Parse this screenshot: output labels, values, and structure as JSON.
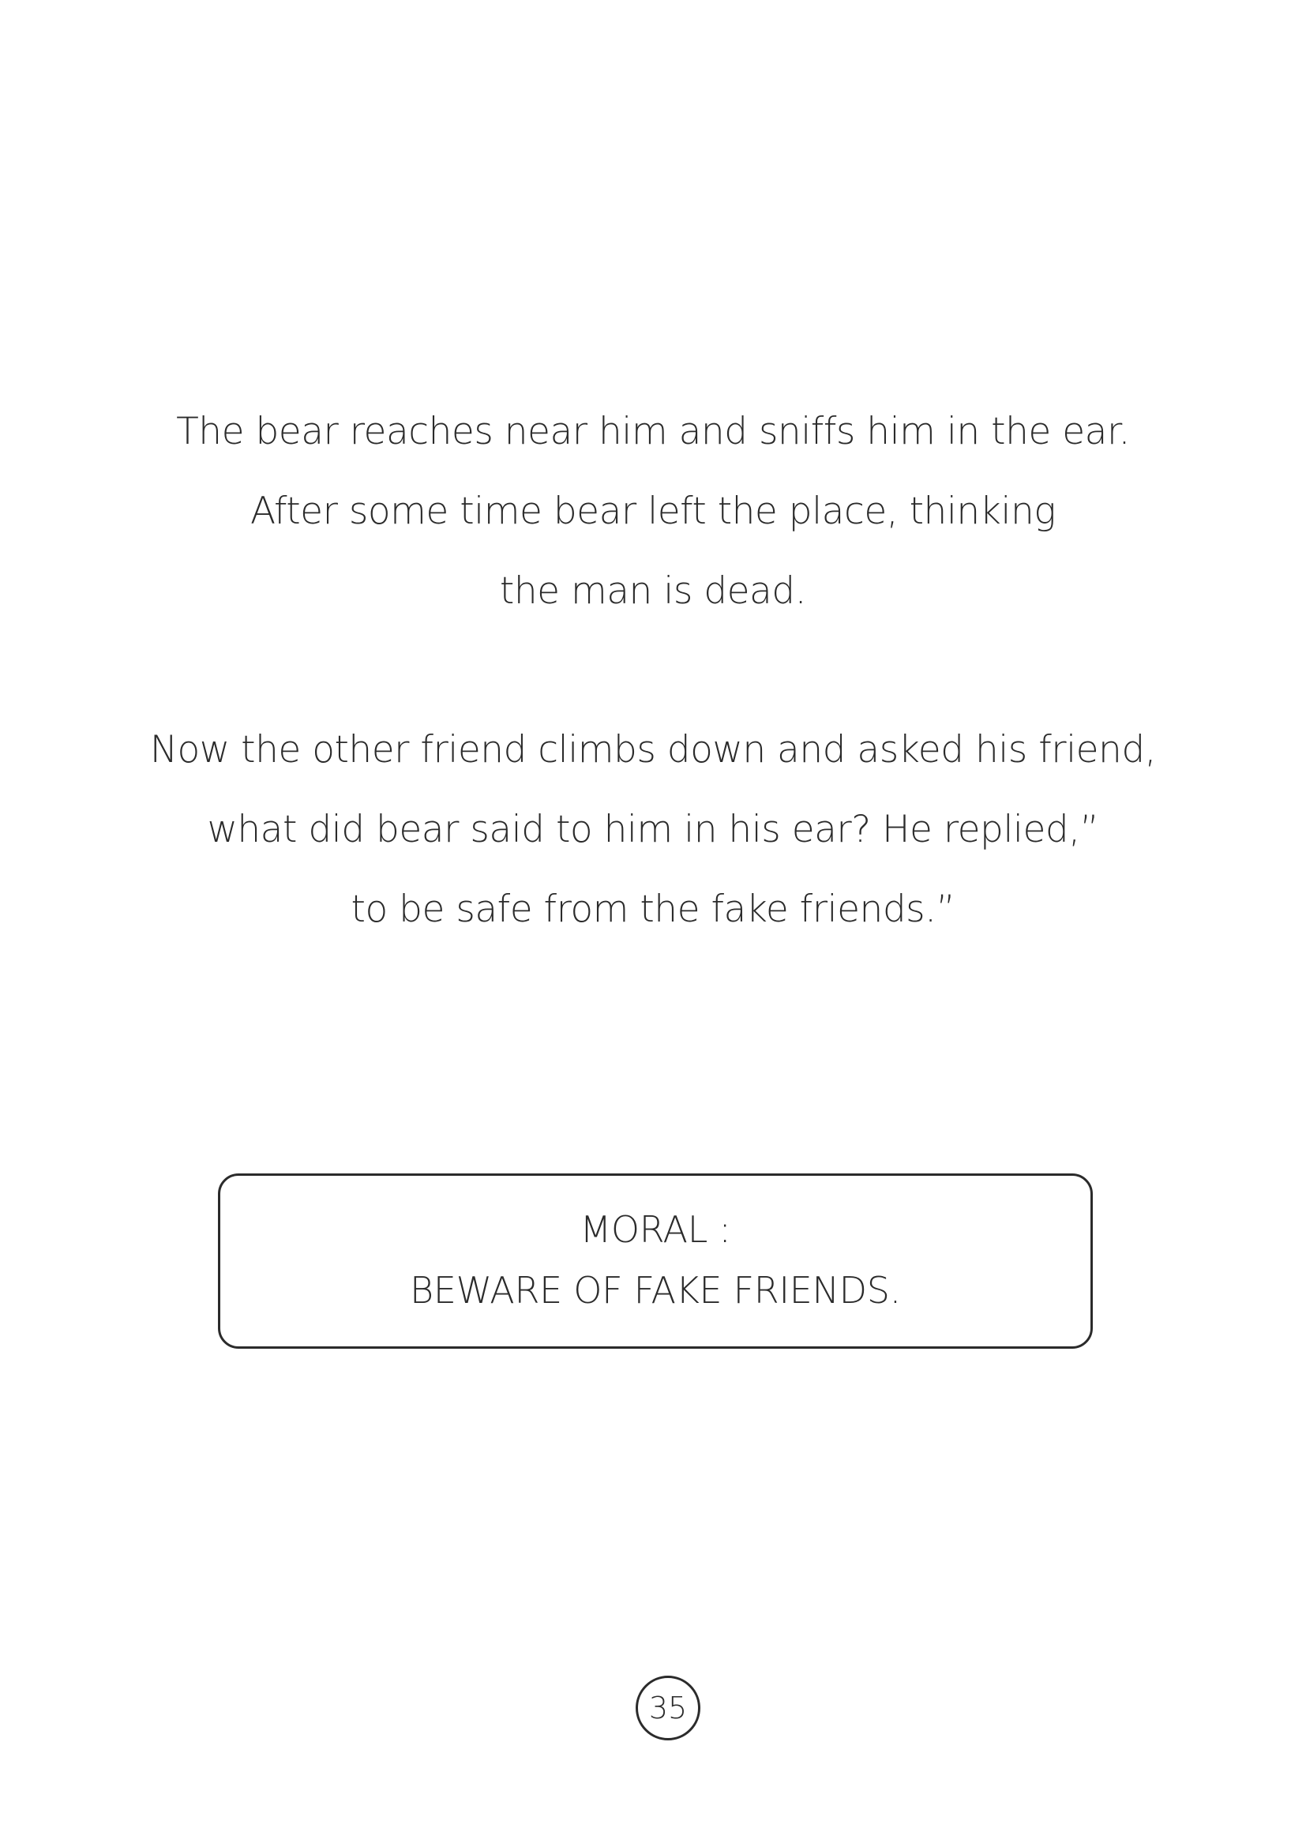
{
  "story": {
    "paragraph_1": [
      "The bear reaches near him and sniffs him in the ear.",
      "After some time bear left the place, thinking",
      "the man is dead."
    ],
    "paragraph_2": [
      "Now the other friend climbs down and asked his friend,",
      "what did bear said to him in his ear? He replied,”",
      "to be safe from the fake friends.”"
    ]
  },
  "moral": {
    "heading": "MORAL :",
    "text": "BEWARE OF FAKE FRIENDS."
  },
  "page_number": "35"
}
